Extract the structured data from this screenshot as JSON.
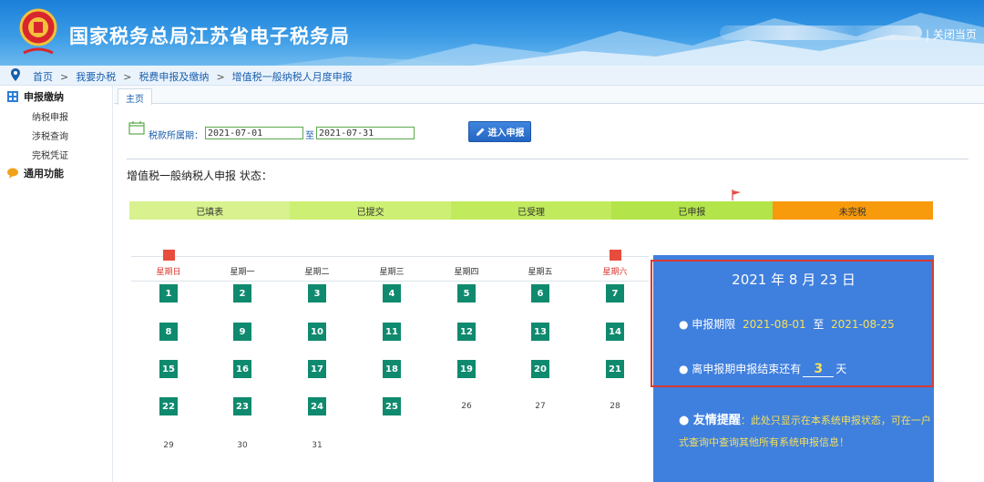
{
  "header": {
    "title": "国家税务总局江苏省电子税务局",
    "close_link": "| 关闭当页"
  },
  "breadcrumb": [
    "首页",
    "我要办税",
    "税费申报及缴纳",
    "增值税一般纳税人月度申报"
  ],
  "breadcrumb_separator": ">",
  "sidebar": {
    "groups": [
      {
        "label": "申报缴纳",
        "items": [
          "纳税申报",
          "涉税查询",
          "完税凭证"
        ]
      },
      {
        "label": "通用功能",
        "items": []
      }
    ]
  },
  "tabs": [
    "主页"
  ],
  "period": {
    "label": "税款所属期：",
    "start": "2021-07-01",
    "to": "至",
    "end": "2021-07-31"
  },
  "enter_button": "进入申报",
  "status_title": "增值税一般纳税人申报 状态：",
  "steps": [
    {
      "label": "已填表",
      "color": "#d9f28f"
    },
    {
      "label": "已提交",
      "color": "#cdef73"
    },
    {
      "label": "已受理",
      "color": "#c1eb5d"
    },
    {
      "label": "已申报",
      "color": "#b3e44a"
    },
    {
      "label": "未完税",
      "color": "#f79a0c"
    }
  ],
  "calendar": {
    "weekdays": [
      "星期日",
      "星期一",
      "星期二",
      "星期三",
      "星期四",
      "星期五",
      "星期六"
    ],
    "weeks": [
      [
        {
          "d": "1",
          "on": true
        },
        {
          "d": "2",
          "on": true
        },
        {
          "d": "3",
          "on": true
        },
        {
          "d": "4",
          "on": true
        },
        {
          "d": "5",
          "on": true
        },
        {
          "d": "6",
          "on": true
        },
        {
          "d": "7",
          "on": true
        }
      ],
      [
        {
          "d": "8",
          "on": true
        },
        {
          "d": "9",
          "on": true
        },
        {
          "d": "10",
          "on": true
        },
        {
          "d": "11",
          "on": true
        },
        {
          "d": "12",
          "on": true
        },
        {
          "d": "13",
          "on": true
        },
        {
          "d": "14",
          "on": true
        }
      ],
      [
        {
          "d": "15",
          "on": true
        },
        {
          "d": "16",
          "on": true
        },
        {
          "d": "17",
          "on": true
        },
        {
          "d": "18",
          "on": true
        },
        {
          "d": "19",
          "on": true
        },
        {
          "d": "20",
          "on": true
        },
        {
          "d": "21",
          "on": true
        }
      ],
      [
        {
          "d": "22",
          "on": true
        },
        {
          "d": "23",
          "on": true
        },
        {
          "d": "24",
          "on": true
        },
        {
          "d": "25",
          "on": true
        },
        {
          "d": "26",
          "on": false
        },
        {
          "d": "27",
          "on": false
        },
        {
          "d": "28",
          "on": false
        }
      ],
      [
        {
          "d": "29",
          "on": false
        },
        {
          "d": "30",
          "on": false
        },
        {
          "d": "31",
          "on": false
        }
      ]
    ]
  },
  "info": {
    "date": "2021 年 8 月 23 日",
    "deadline_label": "● 申报期限",
    "deadline_start": "2021-08-01",
    "deadline_to": "至",
    "deadline_end": "2021-08-25",
    "remaining_label": "● 离申报期申报结束还有",
    "remaining_days": "3",
    "remaining_unit": "天",
    "tip_title": "● 友情提醒",
    "tip_text": "：此处只显示在本系统申报状态，可在一户式查询中查询其他所有系统申报信息！"
  }
}
